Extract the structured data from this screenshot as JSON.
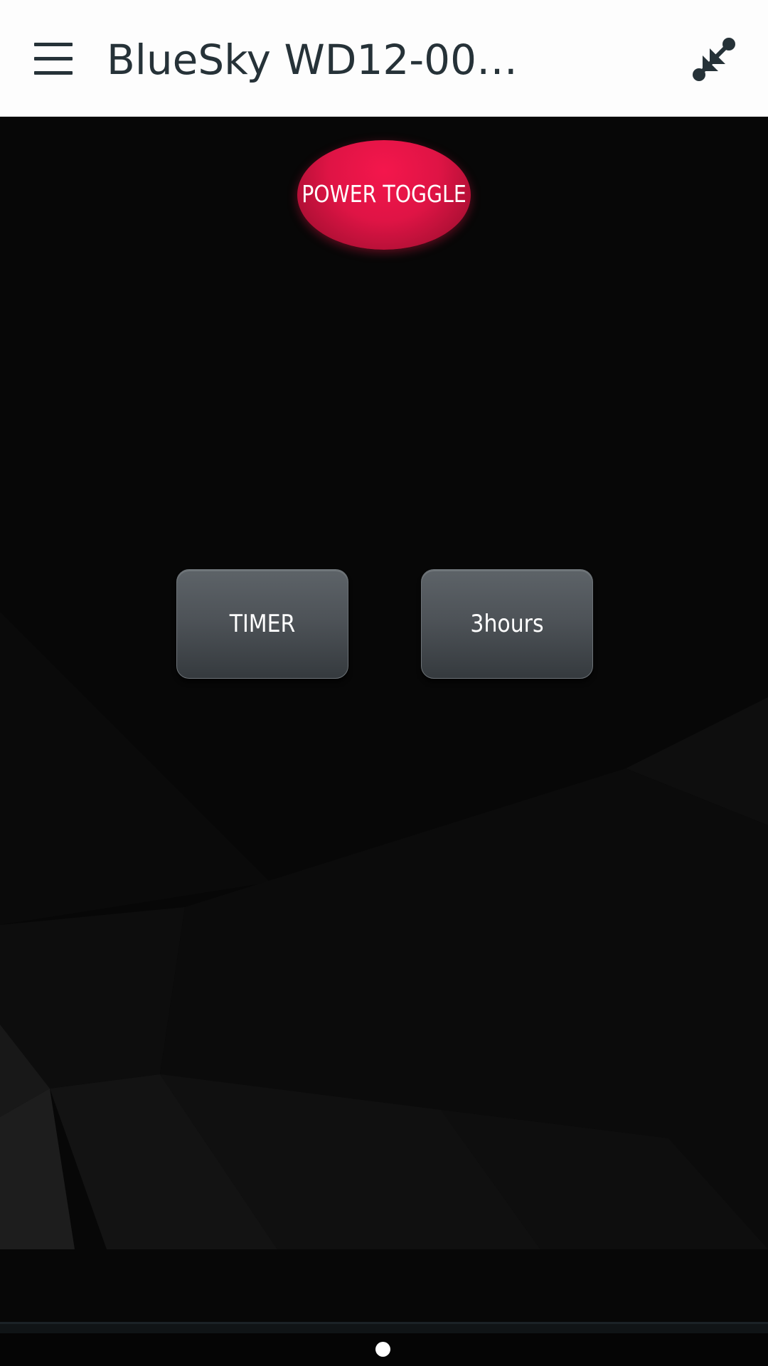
{
  "app_bar": {
    "title": "BlueSky WD12-000…",
    "menu_icon": "hamburger-menu-icon",
    "collapse_icon": "collapse-arrows-icon",
    "background_color": "#fdfdfd",
    "text_color": "#263238"
  },
  "remote": {
    "power_label": "POWER TOGGLE",
    "timer_label": "TIMER",
    "hours_label": "3hours",
    "power_color": "#e0144a",
    "button_color": "#4e5358"
  },
  "pager": {
    "pages": 1,
    "current": 1
  }
}
